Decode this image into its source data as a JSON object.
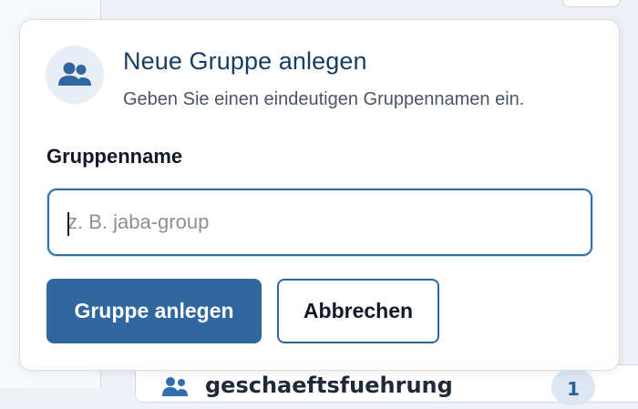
{
  "modal": {
    "icon": "users-icon",
    "title": "Neue Gruppe anlegen",
    "subtitle": "Geben Sie einen eindeutigen Gruppennamen ein.",
    "field_label": "Gruppenname",
    "input_value": "",
    "input_placeholder": "z. B. jaba-group",
    "primary_label": "Gruppe anlegen",
    "secondary_label": "Abbrechen"
  },
  "background": {
    "row_label": "geschaeftsfuehrung",
    "row_badge": "1",
    "row_icon": "users-icon"
  },
  "colors": {
    "accent": "#30679f",
    "title": "#163e63",
    "icon_bg": "#e8eef5"
  }
}
